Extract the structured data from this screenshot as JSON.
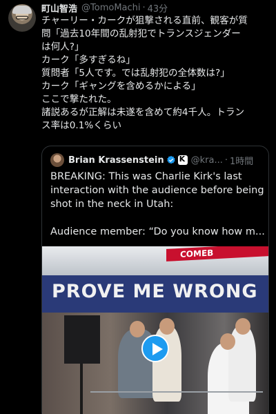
{
  "tweet": {
    "display_name": "町山智浩",
    "handle": "@TomoMachi",
    "separator": "·",
    "time": "43分",
    "lines": [
      "チャーリー・カークが狙撃される直前、観客が質",
      "問「過去10年間の乱射犯でトランスジェンダー",
      "は何人?」",
      "カーク「多すぎるね」",
      "質問者「5人です。では乱射犯の全体数は?」",
      "カーク「ギャングを含めるかによる」",
      "ここで撃たれた。",
      "諸説あるが正解は未遂を含めて約4千人。トラン",
      "ス率は0.1%くらい"
    ]
  },
  "quote": {
    "display_name": "Brian Krassenstein",
    "handle": "@kra...",
    "separator": "·",
    "time": "1時間",
    "lines": [
      "BREAKING:  This was Charlie Kirk's last",
      "interaction with the audience before being",
      "shot in the neck in Utah:",
      "",
      "Audience member: “Do you know how m..."
    ],
    "media": {
      "banner_text": "PROVE ME WRONG",
      "top_banner_text": "COMEB"
    }
  },
  "colors": {
    "background": "#000000",
    "text": "#e7e9ea",
    "muted": "#71767b",
    "accent": "#1d9bf0"
  },
  "icons": [
    "verified-badge-icon",
    "affiliate-badge-icon",
    "play-icon"
  ]
}
